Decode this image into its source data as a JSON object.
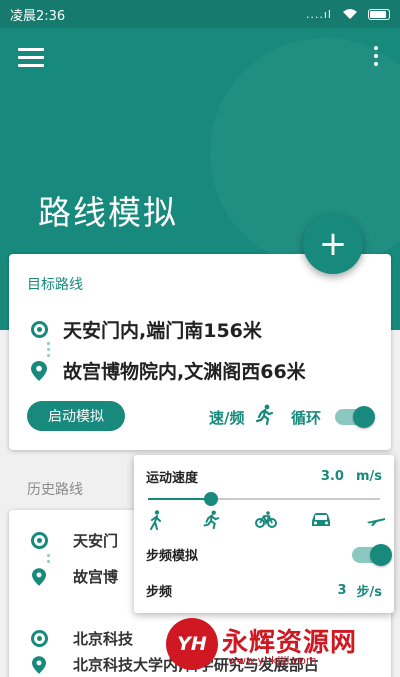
{
  "status_bar": {
    "time": "凌晨2:36",
    "signal": "....ıl"
  },
  "app_bar": {
    "title": "路线模拟",
    "fab_label": "+"
  },
  "target_route": {
    "label": "目标路线",
    "start": "天安门内,端门南156米",
    "end": "故宫博物院内,文渊阁西66米",
    "start_button": "启动模拟",
    "speed_freq_label": "速/频",
    "loop_label": "循环",
    "loop_enabled": true
  },
  "history": {
    "label": "历史路线",
    "items": [
      {
        "start": "天安门",
        "end": "故宫博"
      },
      {
        "start": "北京科技",
        "end": "北京科技大学内,科学研究与发展部占"
      }
    ]
  },
  "speed_popup": {
    "speed_label": "运动速度",
    "speed_value": "3.0",
    "speed_unit": "m/s",
    "speed_slider_fraction": 0.27,
    "step_freq_label": "步频模拟",
    "step_freq_enabled": true,
    "steps_label": "步频",
    "steps_value": "3",
    "steps_unit": "步/s",
    "modes": [
      "walk-icon",
      "run-icon",
      "bike-icon",
      "car-icon",
      "plane-icon"
    ]
  },
  "watermark": {
    "logo": "YH",
    "text": "永辉资源网",
    "url": "www.yhkjljl.com"
  },
  "colors": {
    "accent": "#188a7d",
    "statusbar": "#177a6e",
    "watermark": "#d01822"
  }
}
